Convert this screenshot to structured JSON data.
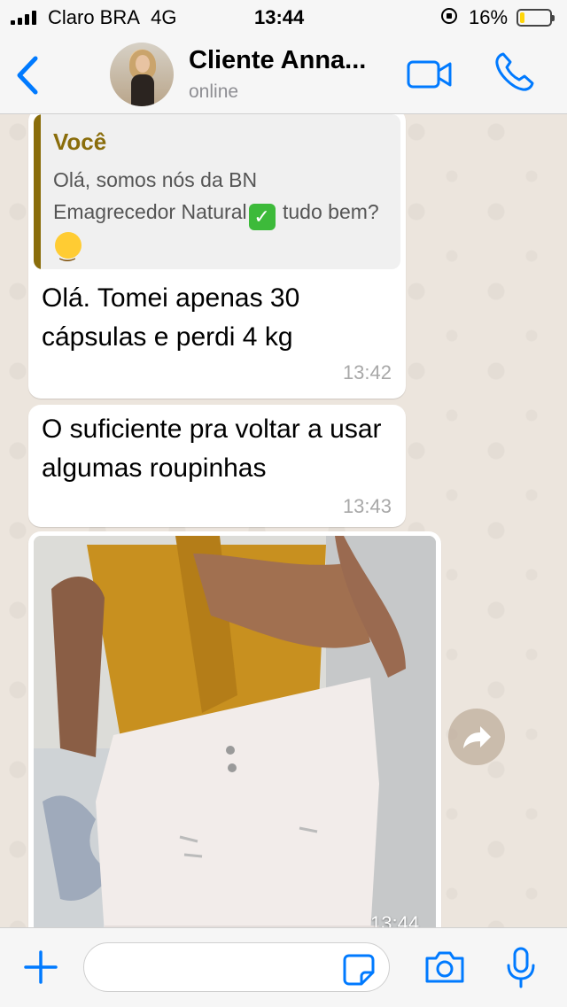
{
  "status_bar": {
    "carrier": "Claro BRA",
    "network": "4G",
    "time": "13:44",
    "battery_percent": "16%",
    "battery_level": 0.16,
    "battery_color": "#ffd60a"
  },
  "header": {
    "contact_name": "Cliente Anna...",
    "status": "online",
    "accent_color": "#007aff",
    "icons": [
      "back-chevron-icon",
      "video-call-icon",
      "phone-call-icon"
    ]
  },
  "messages": [
    {
      "quote": {
        "author": "Você",
        "text_part1": "Olá, somos nós da BN Emagrecedor Natural",
        "emoji1": "check-mark-emoji",
        "text_part2": " tudo bem?",
        "emoji2": "smiling-face-emoji"
      },
      "text": "Olá. Tomei apenas 30 cápsulas e perdi 4 kg",
      "time": "13:42"
    },
    {
      "text": "O suficiente pra voltar a usar algumas roupinhas",
      "time": "13:43"
    },
    {
      "type": "photo",
      "time": "13:44"
    }
  ],
  "input_bar": {
    "placeholder": "",
    "icons": [
      "plus-icon",
      "sticker-icon",
      "camera-icon",
      "microphone-icon"
    ]
  },
  "colors": {
    "quote_accent": "#8a6d0b",
    "chat_background": "#ece5dd",
    "bar_background": "#f6f6f6"
  }
}
